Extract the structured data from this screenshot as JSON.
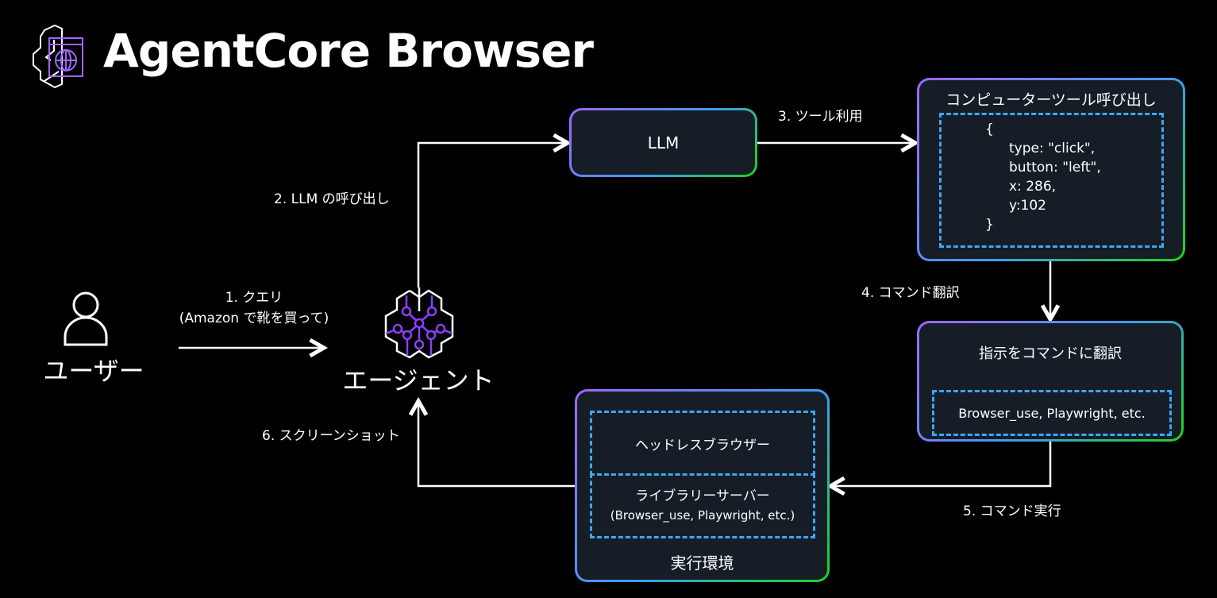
{
  "title": "AgentCore Browser",
  "colors": {
    "box_bg": "#161d26",
    "gradient": [
      "#a166ff",
      "#3f9cf6",
      "#1fd11f"
    ],
    "dash": "#3aa8f5",
    "icon_accent": "#8a3ffc"
  },
  "nodes": {
    "user": "ユーザー",
    "agent": "エージェント",
    "llm": "LLM",
    "tool_call": {
      "title": "コンピューターツール呼び出し",
      "code": [
        "{",
        "type: \"click\",",
        "button: \"left\",",
        "x: 286,",
        "y:102",
        "}"
      ]
    },
    "translate": {
      "title": "指示をコマンドに翻訳",
      "inner": "Browser_use, Playwright, etc."
    },
    "env": {
      "title": "実行環境",
      "browser": "ヘッドレスブラウザー",
      "server": "ライブラリーサーバー",
      "server_sub": "(Browser_use, Playwright, etc.)"
    }
  },
  "edges": {
    "e1": "1. クエリ",
    "e1_sub": "(Amazon で靴を買って)",
    "e2": "2. LLM の呼び出し",
    "e3": "3. ツール利用",
    "e4": "4. コマンド翻訳",
    "e5": "5. コマンド実行",
    "e6": "6. スクリーンショット"
  }
}
